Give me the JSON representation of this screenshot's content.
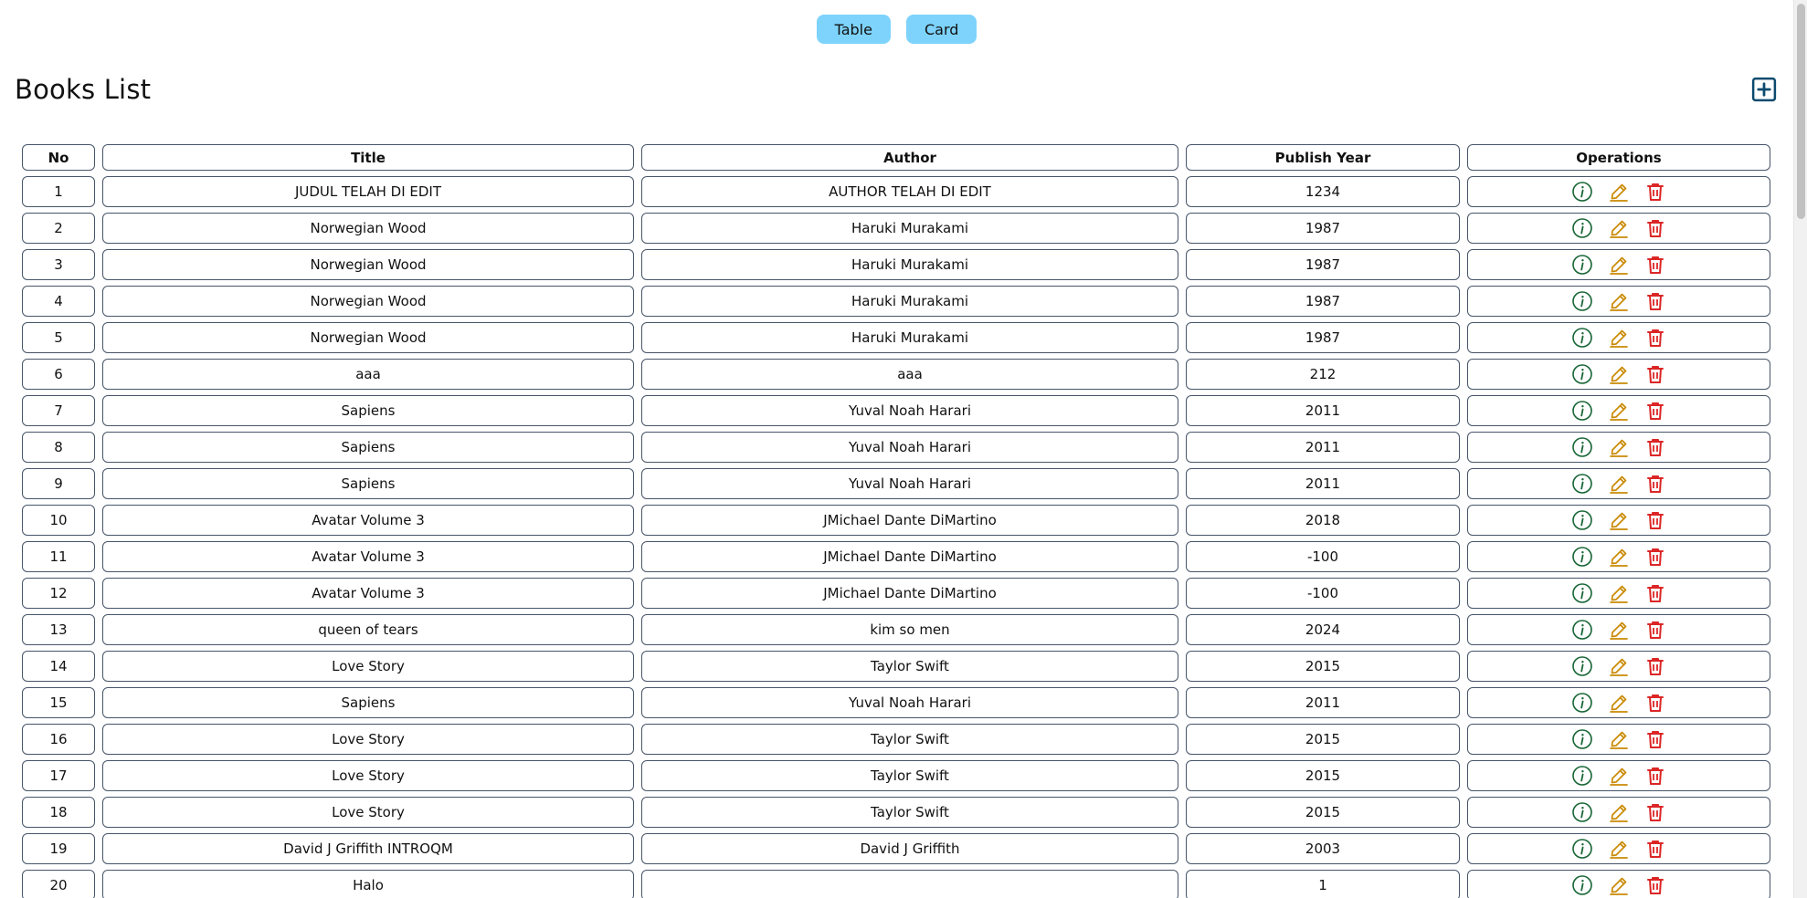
{
  "view_toggle": {
    "table_label": "Table",
    "card_label": "Card"
  },
  "page": {
    "title": "Books List"
  },
  "colors": {
    "toggle_bg": "#7dd3fc",
    "add_icon": "#0c4a6e",
    "info_icon": "#166534",
    "edit_icon": "#ca8a04",
    "delete_icon": "#dc2626",
    "cell_border": "#475569"
  },
  "icons": {
    "add": "plus-square-icon",
    "info": "info-circle-icon",
    "edit": "pencil-icon",
    "delete": "trash-icon"
  },
  "table": {
    "headers": [
      "No",
      "Title",
      "Author",
      "Publish Year",
      "Operations"
    ],
    "rows": [
      {
        "no": "1",
        "title": "JUDUL TELAH DI EDIT",
        "author": "AUTHOR TELAH DI EDIT",
        "year": "1234"
      },
      {
        "no": "2",
        "title": "Norwegian Wood",
        "author": "Haruki Murakami",
        "year": "1987"
      },
      {
        "no": "3",
        "title": "Norwegian Wood",
        "author": "Haruki Murakami",
        "year": "1987"
      },
      {
        "no": "4",
        "title": "Norwegian Wood",
        "author": "Haruki Murakami",
        "year": "1987"
      },
      {
        "no": "5",
        "title": "Norwegian Wood",
        "author": "Haruki Murakami",
        "year": "1987"
      },
      {
        "no": "6",
        "title": "aaa",
        "author": "aaa",
        "year": "212"
      },
      {
        "no": "7",
        "title": "Sapiens",
        "author": "Yuval Noah Harari",
        "year": "2011"
      },
      {
        "no": "8",
        "title": "Sapiens",
        "author": "Yuval Noah Harari",
        "year": "2011"
      },
      {
        "no": "9",
        "title": "Sapiens",
        "author": "Yuval Noah Harari",
        "year": "2011"
      },
      {
        "no": "10",
        "title": "Avatar Volume 3",
        "author": "JMichael Dante DiMartino",
        "year": "2018"
      },
      {
        "no": "11",
        "title": "Avatar Volume 3",
        "author": "JMichael Dante DiMartino",
        "year": "-100"
      },
      {
        "no": "12",
        "title": "Avatar Volume 3",
        "author": "JMichael Dante DiMartino",
        "year": "-100"
      },
      {
        "no": "13",
        "title": "queen of tears",
        "author": "kim so men",
        "year": "2024"
      },
      {
        "no": "14",
        "title": "Love Story",
        "author": "Taylor Swift",
        "year": "2015"
      },
      {
        "no": "15",
        "title": "Sapiens",
        "author": "Yuval Noah Harari",
        "year": "2011"
      },
      {
        "no": "16",
        "title": "Love Story",
        "author": "Taylor Swift",
        "year": "2015"
      },
      {
        "no": "17",
        "title": "Love Story",
        "author": "Taylor Swift",
        "year": "2015"
      },
      {
        "no": "18",
        "title": "Love Story",
        "author": "Taylor Swift",
        "year": "2015"
      },
      {
        "no": "19",
        "title": "David J Griffith INTROQM",
        "author": "David J Griffith",
        "year": "2003"
      },
      {
        "no": "20",
        "title": "Halo",
        "author": "",
        "year": "1"
      }
    ]
  }
}
